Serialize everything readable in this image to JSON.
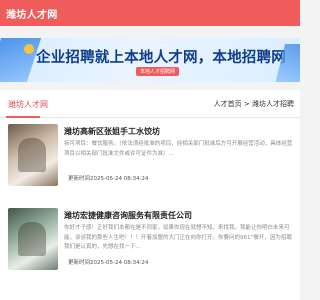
{
  "header": {
    "site_title": "潍坊人才网"
  },
  "banner": {
    "headline": "企业招聘就上本地人才网，本地招聘网",
    "subline": "本地人才招聘网"
  },
  "section": {
    "title": "潍坊人才网",
    "breadcrumb": {
      "home": "人才首页",
      "separator": ">",
      "current": "潍坊人才招聘"
    }
  },
  "articles": [
    {
      "title": "潍坊高新区张姐手工水饺坊",
      "summary": "拆可项目：餐饮服务。（依法须经批准的项目，经相关部门批准后方可开展经营活动，具体经营项目以相关部门批准文件或许可证件为准）...",
      "time": "更新时间2025-05-24 08:34:24"
    },
    {
      "title": "潍坊宏捷健康咨询服务有限责任公司",
      "summary": "你好才子感！正好我们本都在是不同家，如果你现在就想不知，来找我。我能让你明白未来可能，谈谈我的那些人生吧！！！开着加盟的大门正在向你打开。你要问的961”餐开，因为招聘我们是认真的，先想在找一下...",
      "time": "更新时间2025-05-24 08:34:24"
    }
  ]
}
